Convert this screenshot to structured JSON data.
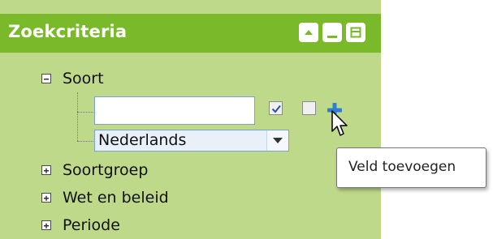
{
  "panel": {
    "title": "Zoekcriteria",
    "colors": {
      "header": "#7ab929",
      "body": "#bfd98b"
    },
    "title_buttons": [
      "collapse-up-icon",
      "minimize-icon",
      "window-icon"
    ]
  },
  "tree": {
    "items": [
      {
        "label": "Soort",
        "state": "expanded"
      },
      {
        "label": "Soortgroep",
        "state": "collapsed"
      },
      {
        "label": "Wet en beleid",
        "state": "collapsed"
      },
      {
        "label": "Periode",
        "state": "collapsed"
      }
    ]
  },
  "soort": {
    "search_value": "",
    "checkbox1_checked": true,
    "checkbox2_checked": false,
    "language_select": "Nederlands",
    "add_field_icon": "plus-icon"
  },
  "tooltip": {
    "text": "Veld toevoegen"
  }
}
